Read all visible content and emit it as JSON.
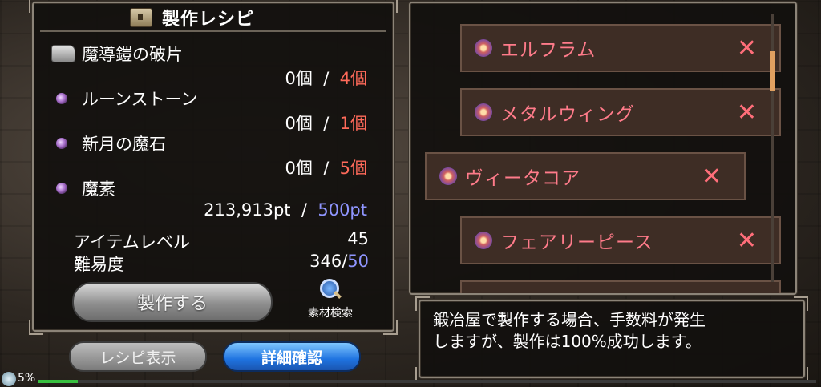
{
  "recipe_panel": {
    "title": "製作レシピ",
    "materials": [
      {
        "name": "魔導鎧の破片",
        "icon": "armor-shard-icon",
        "have": "0個",
        "sep": "/",
        "need": "4個"
      },
      {
        "name": "ルーンストーン",
        "icon": "purple-gem-icon",
        "have": "0個",
        "sep": "/",
        "need": "1個"
      },
      {
        "name": "新月の魔石",
        "icon": "purple-gem-icon",
        "have": "0個",
        "sep": "/",
        "need": "5個"
      },
      {
        "name": "魔素",
        "icon": "purple-gem-icon",
        "have": "213,913pt",
        "sep": "/",
        "need": "500pt"
      }
    ],
    "item_level_label": "アイテムレベル",
    "item_level_value": "45",
    "difficulty_label": "難易度",
    "difficulty_value": "346",
    "difficulty_sep": "/",
    "difficulty_max": "50",
    "craft_button": "製作する",
    "search_label": "素材検索"
  },
  "buttons": {
    "recipe_display": "レシピ表示",
    "detail_confirm": "詳細確認"
  },
  "item_list": [
    {
      "name": "エルフラム",
      "remove": "✕"
    },
    {
      "name": "メタルウィング",
      "remove": "✕"
    },
    {
      "name": "ヴィータコア",
      "remove": "✕"
    },
    {
      "name": "フェアリーピース",
      "remove": "✕"
    }
  ],
  "message": {
    "line1": "鍛冶屋で製作する場合、手数料が発生",
    "line2": "しますが、製作は100%成功します。"
  },
  "status_bar": {
    "percent": "5%",
    "progress": 0.05
  },
  "colors": {
    "need_red": "#ff6a5a",
    "need_blue": "#8f95ff",
    "item_name": "#ff7b8a",
    "detail_button": "#1f73e0"
  }
}
